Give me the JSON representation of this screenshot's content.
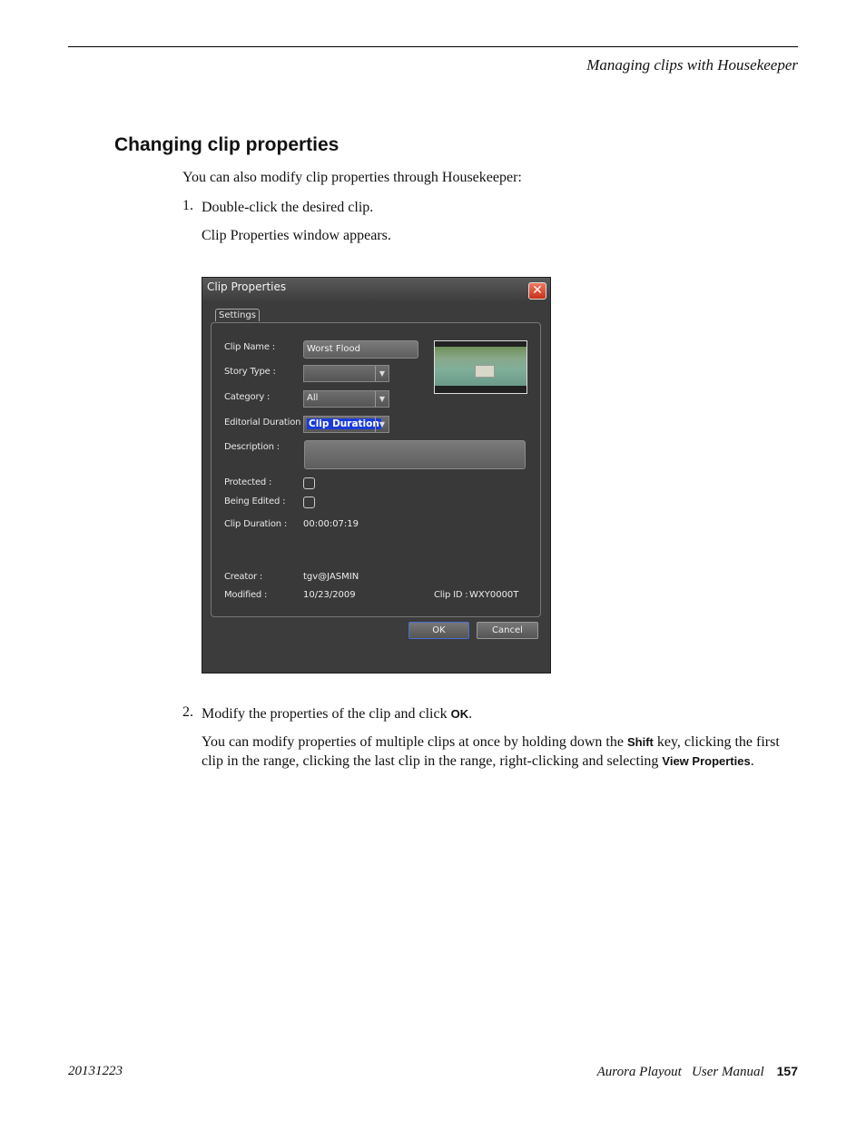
{
  "header": {
    "running_head": "Managing clips with Housekeeper"
  },
  "section": {
    "title": "Changing clip properties",
    "intro": "You can also modify clip properties through Housekeeper:",
    "steps": [
      {
        "num": "1.",
        "text": "Double-click the desired clip.",
        "note": "Clip Properties window appears."
      },
      {
        "num": "2.",
        "text_before": "Modify the properties of the clip and click ",
        "ui_term": "OK",
        "text_after": ".",
        "note_parts": [
          "You can modify properties of multiple clips at once by holding down the ",
          "Shift",
          " key, clicking the first clip in the range, clicking the last clip in the range, right-clicking and selecting ",
          "View Properties",
          "."
        ]
      }
    ]
  },
  "dialog": {
    "title": "Clip Properties",
    "close_icon": "close-x-icon",
    "tab": "Settings",
    "fields": {
      "clip_name": {
        "label": "Clip Name :",
        "value": "Worst Flood"
      },
      "story_type": {
        "label": "Story Type :",
        "value": ""
      },
      "category": {
        "label": "Category :",
        "value": "All"
      },
      "editorial_duration": {
        "label": "Editorial Duration :",
        "value": "Clip Duration"
      },
      "description": {
        "label": "Description :",
        "value": ""
      },
      "protected": {
        "label": "Protected :",
        "checked": false
      },
      "being_edited": {
        "label": "Being Edited :",
        "checked": false
      },
      "clip_duration": {
        "label": "Clip Duration :",
        "value": "00:00:07:19"
      },
      "creator": {
        "label": "Creator :",
        "value": "tgv@JASMIN"
      },
      "modified": {
        "label": "Modified :",
        "value": "10/23/2009"
      },
      "clip_id": {
        "label": "Clip ID :",
        "value": "WXY0000T"
      }
    },
    "buttons": {
      "ok": "OK",
      "cancel": "Cancel"
    }
  },
  "footer": {
    "date": "20131223",
    "manual": "Aurora Playout   User Manual",
    "page": "157"
  }
}
